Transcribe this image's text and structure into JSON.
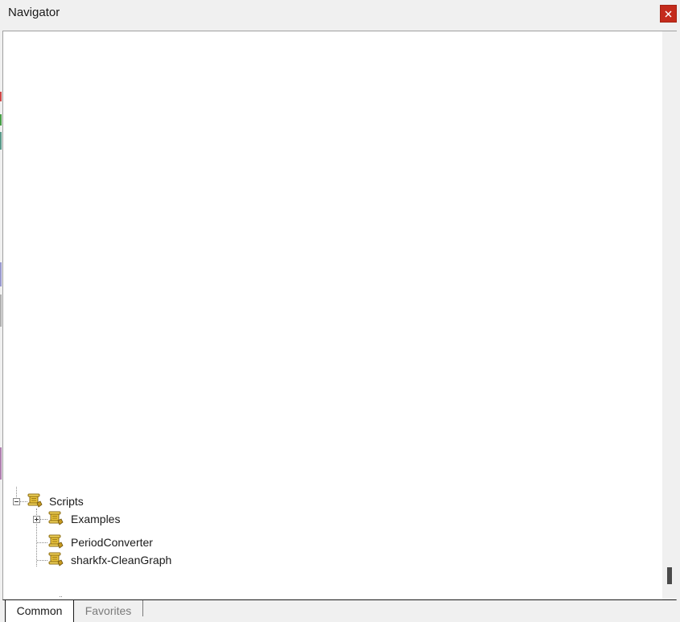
{
  "window": {
    "title": "Navigator",
    "close_label": "×"
  },
  "tree": {
    "root": {
      "label": "Scripts",
      "icon": "script-scroll-icon",
      "expanded": true,
      "children": [
        {
          "label": "Examples",
          "icon": "script-scroll-icon",
          "expandable": true,
          "expanded": false
        },
        {
          "label": "PeriodConverter",
          "icon": "script-scroll-icon",
          "expandable": false
        },
        {
          "label": "sharkfx-CleanGraph",
          "icon": "script-scroll-icon",
          "expandable": false
        }
      ]
    }
  },
  "tabs": [
    {
      "label": "Common",
      "active": true
    },
    {
      "label": "Favorites",
      "active": false
    }
  ],
  "colors": {
    "close_button": "#c42b1c",
    "icon_gold": "#e8c23a",
    "icon_outline": "#8a6a10"
  }
}
